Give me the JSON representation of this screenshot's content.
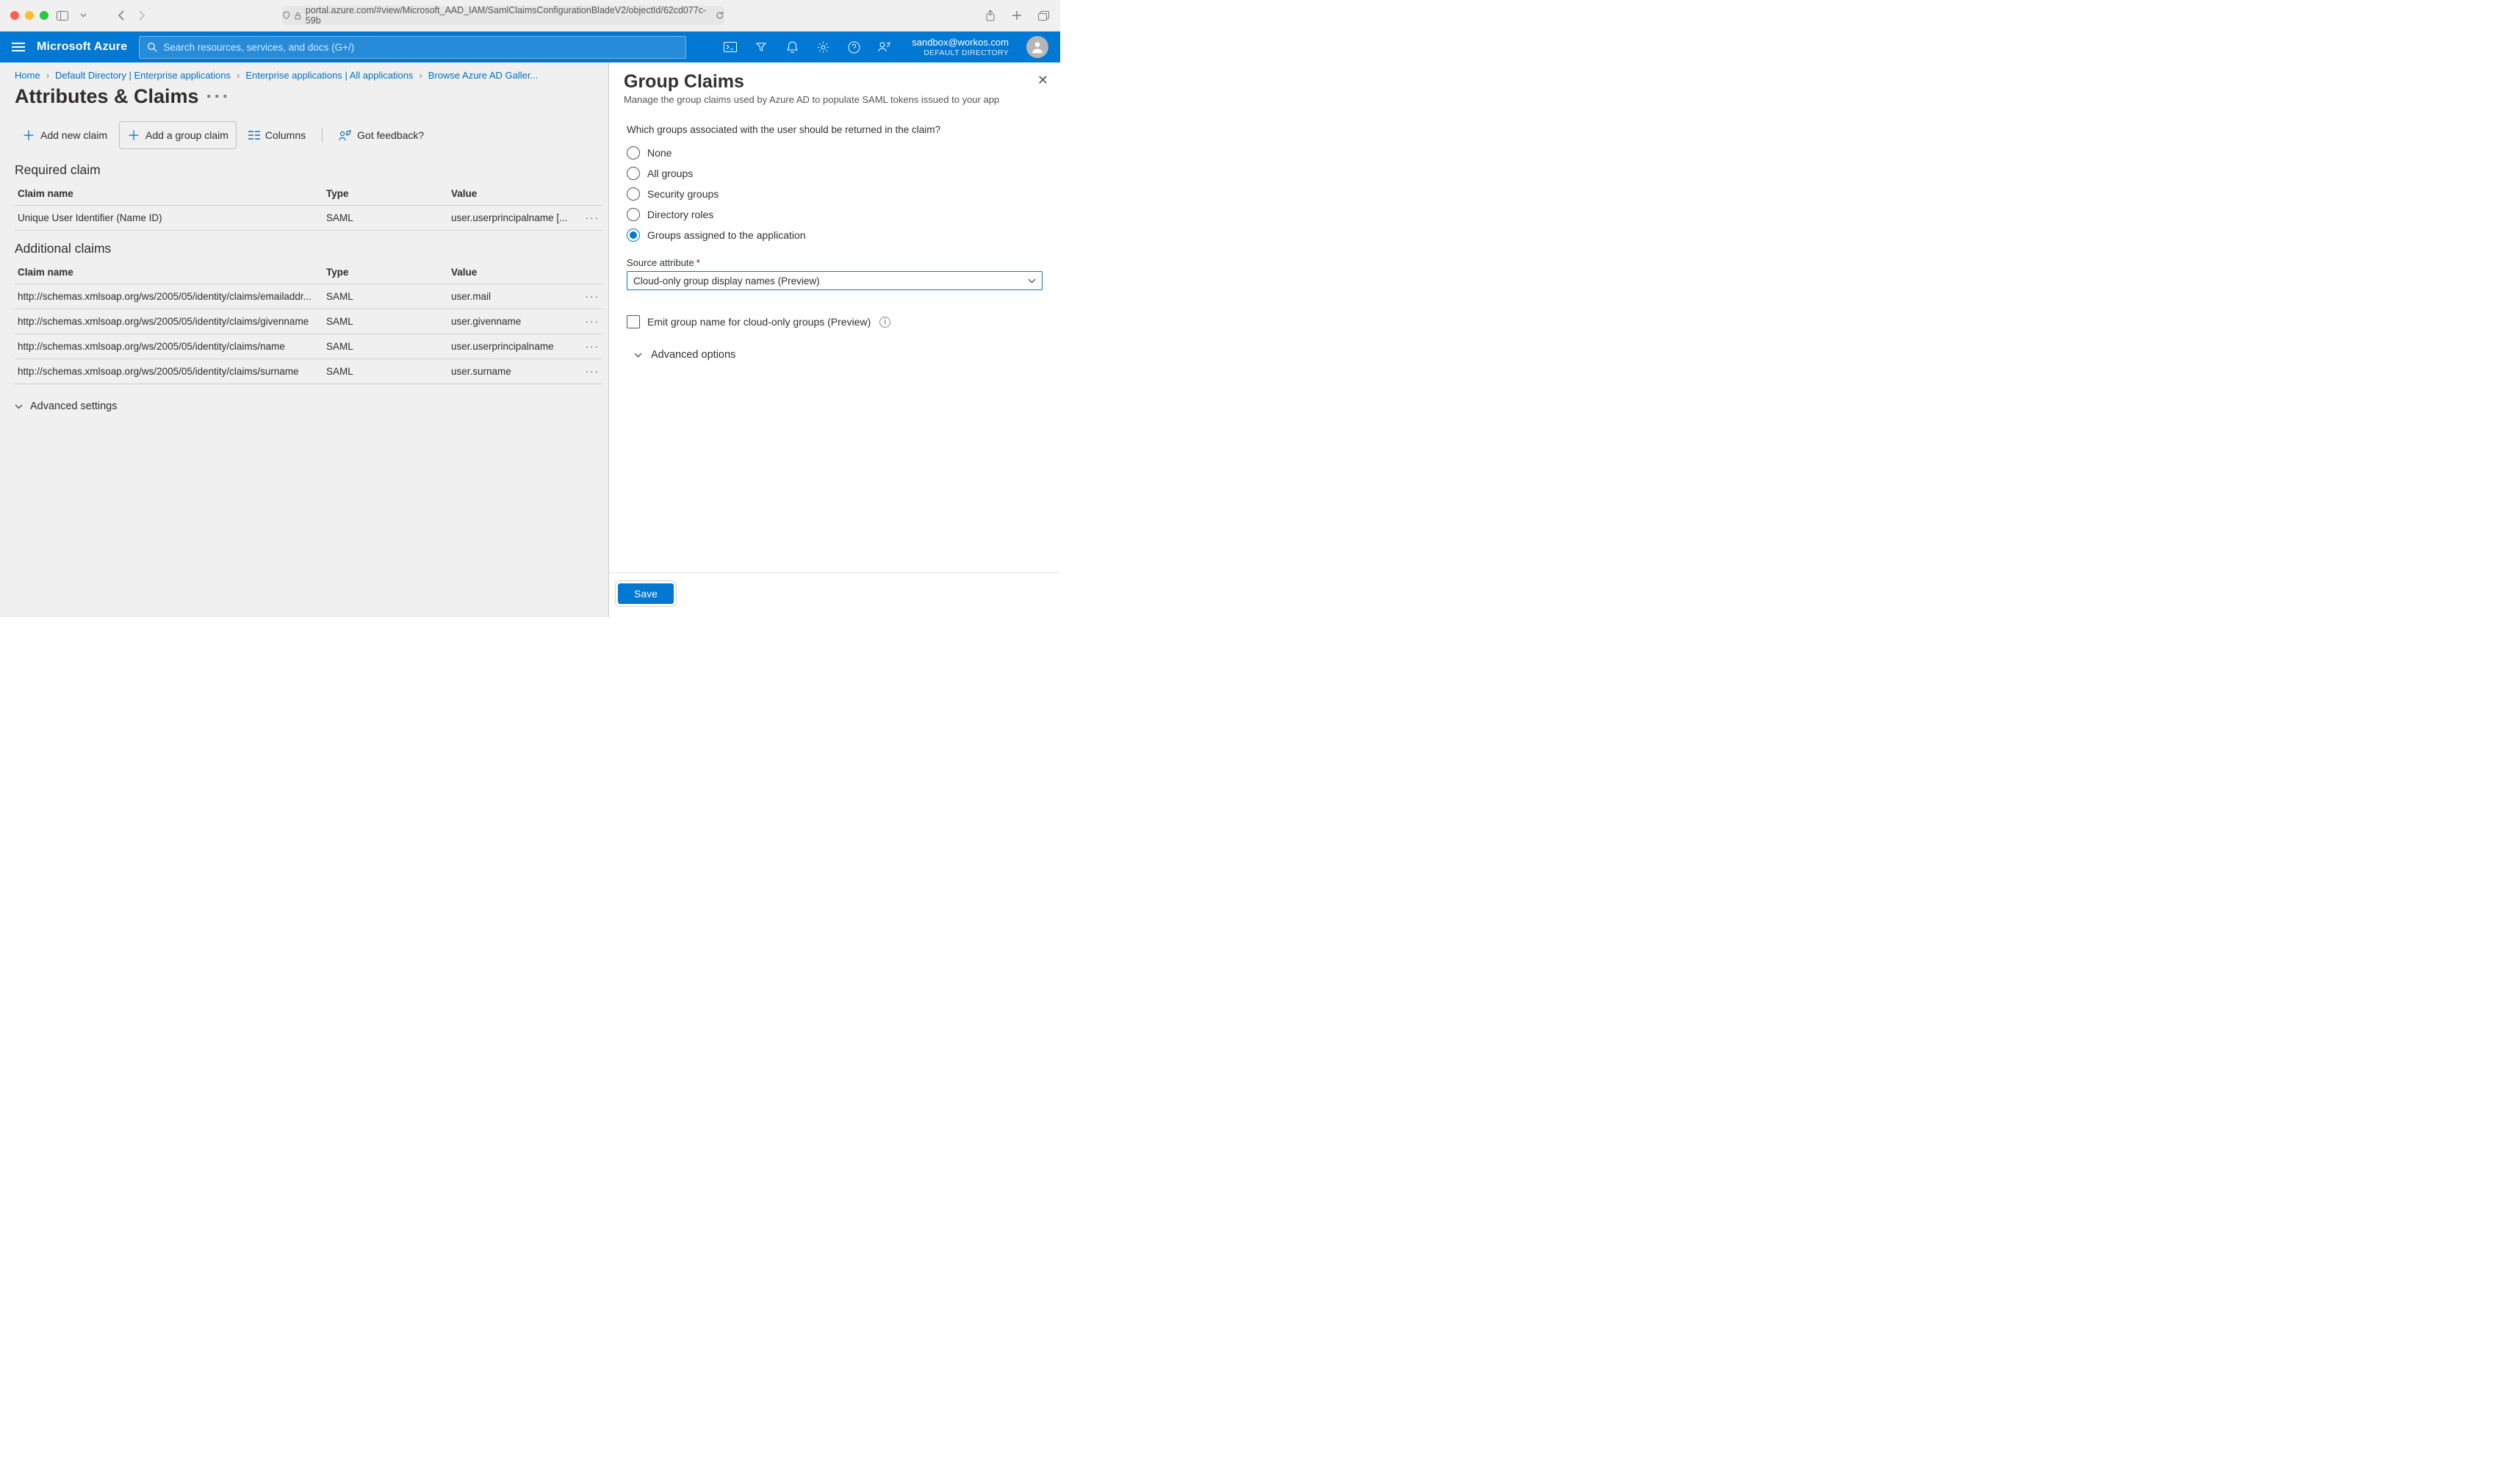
{
  "browser": {
    "url": "portal.azure.com/#view/Microsoft_AAD_IAM/SamlClaimsConfigurationBladeV2/objectId/62cd077c-59b"
  },
  "azure": {
    "brand": "Microsoft Azure",
    "search_placeholder": "Search resources, services, and docs (G+/)",
    "account_email": "sandbox@workos.com",
    "account_dir": "DEFAULT DIRECTORY"
  },
  "breadcrumb": {
    "home": "Home",
    "dir": "Default Directory | Enterprise applications",
    "apps": "Enterprise applications | All applications",
    "browse": "Browse Azure AD Galler..."
  },
  "page_title": "Attributes & Claims",
  "toolbar": {
    "add_new": "Add new claim",
    "add_group": "Add a group claim",
    "columns": "Columns",
    "feedback": "Got feedback?"
  },
  "sections": {
    "required": "Required claim",
    "additional": "Additional claims"
  },
  "headers": {
    "name": "Claim name",
    "type": "Type",
    "value": "Value"
  },
  "required_claims": [
    {
      "name": "Unique User Identifier (Name ID)",
      "type": "SAML",
      "value": "user.userprincipalname [..."
    }
  ],
  "additional_claims": [
    {
      "name": "http://schemas.xmlsoap.org/ws/2005/05/identity/claims/emailaddr...",
      "type": "SAML",
      "value": "user.mail"
    },
    {
      "name": "http://schemas.xmlsoap.org/ws/2005/05/identity/claims/givenname",
      "type": "SAML",
      "value": "user.givenname"
    },
    {
      "name": "http://schemas.xmlsoap.org/ws/2005/05/identity/claims/name",
      "type": "SAML",
      "value": "user.userprincipalname"
    },
    {
      "name": "http://schemas.xmlsoap.org/ws/2005/05/identity/claims/surname",
      "type": "SAML",
      "value": "user.surname"
    }
  ],
  "advanced_settings": "Advanced settings",
  "panel": {
    "title": "Group Claims",
    "subtitle": "Manage the group claims used by Azure AD to populate SAML tokens issued to your app",
    "question": "Which groups associated with the user should be returned in the claim?",
    "options": {
      "none": "None",
      "all": "All groups",
      "security": "Security groups",
      "dirroles": "Directory roles",
      "assigned": "Groups assigned to the application"
    },
    "source_label": "Source attribute",
    "source_value": "Cloud-only group display names (Preview)",
    "emit_label": "Emit group name for cloud-only groups (Preview)",
    "advanced_options": "Advanced options",
    "save": "Save"
  }
}
